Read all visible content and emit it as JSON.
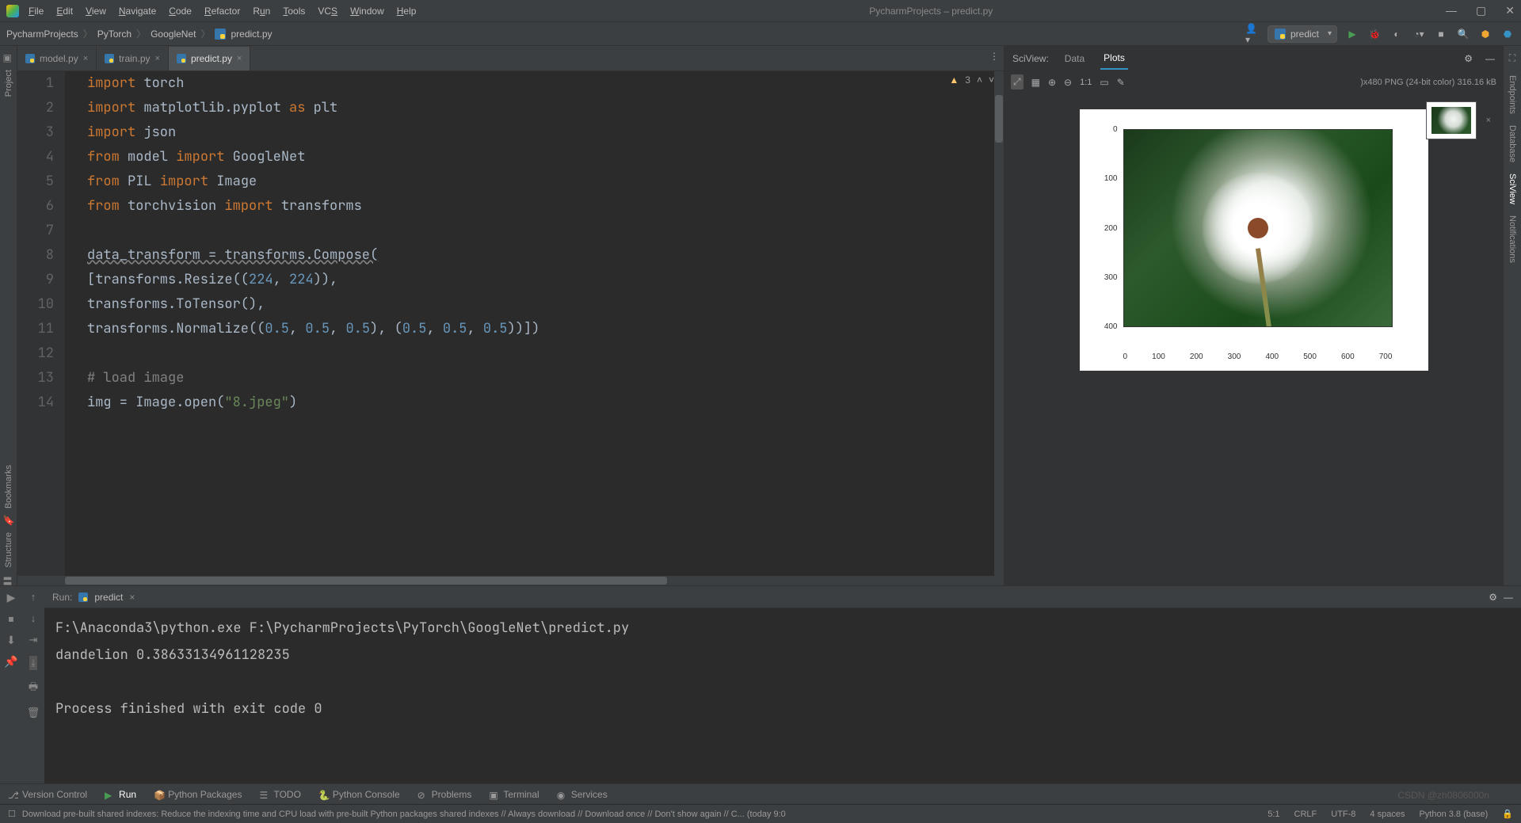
{
  "window": {
    "title": "PycharmProjects – predict.py",
    "menu": [
      "File",
      "Edit",
      "View",
      "Navigate",
      "Code",
      "Refactor",
      "Run",
      "Tools",
      "VCS",
      "Window",
      "Help"
    ]
  },
  "breadcrumb": [
    "PycharmProjects",
    "PyTorch",
    "GoogleNet",
    "predict.py"
  ],
  "run_config": "predict",
  "tabs": [
    {
      "name": "model.py",
      "active": false
    },
    {
      "name": "train.py",
      "active": false
    },
    {
      "name": "predict.py",
      "active": true
    }
  ],
  "inspection": {
    "warnings": "3"
  },
  "code_lines": [
    "1",
    "2",
    "3",
    "4",
    "5",
    "6",
    "7",
    "8",
    "9",
    "10",
    "11",
    "12",
    "13",
    "14"
  ],
  "code": {
    "l1a": "import",
    "l1b": "torch",
    "l2a": "import",
    "l2b": "matplotlib.pyplot",
    "l2c": "as",
    "l2d": "plt",
    "l3a": "import",
    "l3b": "json",
    "l4a": "from",
    "l4b": "model",
    "l4c": "import",
    "l4d": "GoogleNet",
    "l5a": "from",
    "l5b": "PIL",
    "l5c": "import",
    "l5d": "Image",
    "l6a": "from",
    "l6b": "torchvision",
    "l6c": "import",
    "l6d": "transforms",
    "l8": "data_transform = transforms.Compose(",
    "l9a": "    [transforms.Resize((",
    "l9n1": "224",
    "l9s1": ", ",
    "l9n2": "224",
    "l9b": ")),",
    "l10": "     transforms.ToTensor(),",
    "l11a": "     transforms.Normalize((",
    "l11n1": "0.5",
    "l11s1": ", ",
    "l11n2": "0.5",
    "l11s2": ", ",
    "l11n3": "0.5",
    "l11b": "), (",
    "l11n4": "0.5",
    "l11s3": ", ",
    "l11n5": "0.5",
    "l11s4": ", ",
    "l11n6": "0.5",
    "l11c": "))])",
    "l13": "# load image",
    "l14a": "img = Image.open(",
    "l14s": "\"8.jpeg\"",
    "l14b": ")"
  },
  "sciview": {
    "label": "SciView:",
    "tabs": [
      "Data",
      "Plots"
    ],
    "zoom": "1:1",
    "meta": ")x480 PNG (24-bit color) 316.16 kB"
  },
  "chart_data": {
    "type": "image_plot",
    "y_ticks": [
      "0",
      "100",
      "200",
      "300",
      "400"
    ],
    "x_ticks": [
      "0",
      "100",
      "200",
      "300",
      "400",
      "500",
      "600",
      "700"
    ],
    "description": "dandelion image displayed via matplotlib imshow"
  },
  "run": {
    "label": "Run:",
    "config": "predict",
    "output": "F:\\Anaconda3\\python.exe F:\\PycharmProjects\\PyTorch\\GoogleNet\\predict.py\ndandelion 0.38633134961128235\n\nProcess finished with exit code 0"
  },
  "bottom_tools": {
    "version_control": "Version Control",
    "run": "Run",
    "python_packages": "Python Packages",
    "todo": "TODO",
    "python_console": "Python Console",
    "problems": "Problems",
    "terminal": "Terminal",
    "services": "Services"
  },
  "status": {
    "msg": "Download pre-built shared indexes: Reduce the indexing time and CPU load with pre-built Python packages shared indexes // Always download // Download once // Don't show again // C... (today 9:0",
    "pos": "5:1",
    "le": "CRLF",
    "enc": "UTF-8",
    "indent": "4 spaces",
    "interp": "Python 3.8 (base)",
    "watermark": "CSDN @zh0806000n"
  },
  "left_tools": [
    "Project",
    "Bookmarks",
    "Structure"
  ],
  "right_tools": [
    "Endpoints",
    "Database",
    "SciView",
    "Notifications"
  ]
}
